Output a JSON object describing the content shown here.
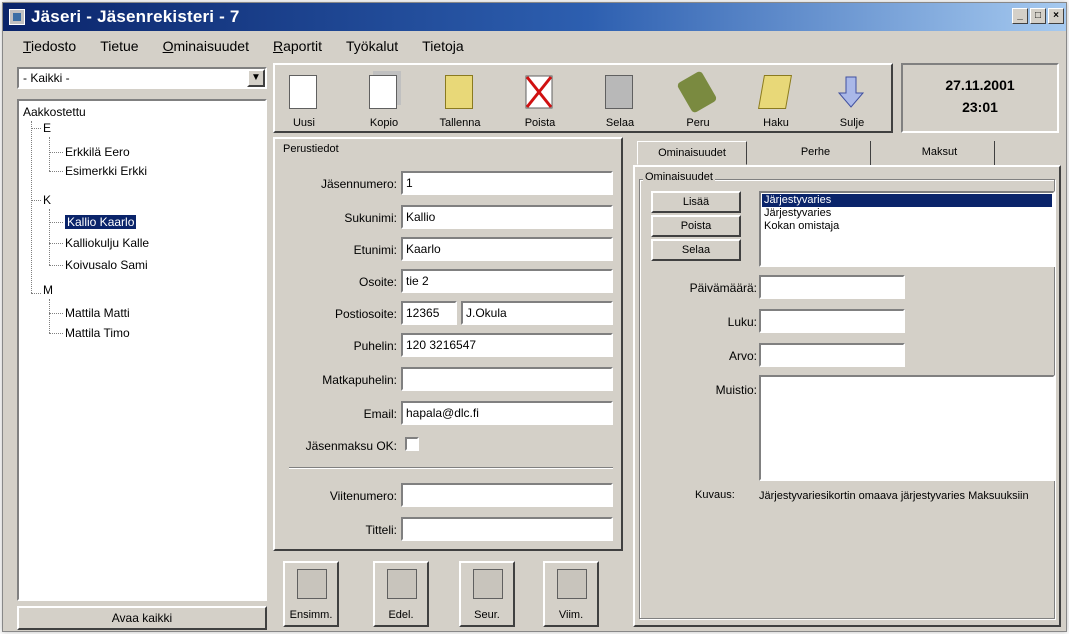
{
  "window": {
    "title": "Jäseri - Jäsenrekisteri - 7",
    "controls": [
      "_",
      "□",
      "×"
    ]
  },
  "menu": [
    {
      "u": "T",
      "rest": "iedosto"
    },
    {
      "u": "",
      "rest": "Tietue"
    },
    {
      "u": "O",
      "rest": "minaisuudet"
    },
    {
      "u": "R",
      "rest": "aportit"
    },
    {
      "u": "",
      "rest": "Työkalut"
    },
    {
      "u": "",
      "rest": "Tietoja"
    }
  ],
  "filter": {
    "value": "- Kaikki -"
  },
  "tree": {
    "root": "Aakkostettu",
    "groups": [
      {
        "letter": "E",
        "items": [
          "Erkkilä Eero",
          "Esimerkki Erkki"
        ]
      },
      {
        "letter": "K",
        "items": [
          "Kallio Kaarlo",
          "Kalliokulju Kalle",
          "Koivusalo Sami"
        ]
      },
      {
        "letter": "M",
        "items": [
          "Mattila Matti",
          "Mattila Timo"
        ]
      }
    ],
    "selected": "Kallio Kaarlo"
  },
  "open_all_label": "Avaa kaikki",
  "toolbar": [
    "Uusi",
    "Kopio",
    "Tallenna",
    "Poista",
    "Selaa",
    "Peru",
    "Haku",
    "Sulje"
  ],
  "datetime": {
    "date": "27.11.2001",
    "time": "23:01"
  },
  "basic": {
    "title": "Perustiedot",
    "member_no_label": "Jäsennumero:",
    "member_no": "1",
    "lastname_label": "Sukunimi:",
    "lastname": "Kallio",
    "firstname_label": "Etunimi:",
    "firstname": "Kaarlo",
    "address_label": "Osoite:",
    "address": "tie 2",
    "postal_label": "Postiosoite:",
    "postal_code": "12365",
    "city": "J.Okula",
    "phone_label": "Puhelin:",
    "phone": "120 3216547",
    "mobile_label": "Matkapuhelin:",
    "mobile": "",
    "email_label": "Email:",
    "email": "hapala@dlc.fi",
    "fee_label": "Jäsenmaksu OK:",
    "ref_label": "Viitenumero:",
    "ref": "",
    "title2_label": "Titteli:",
    "title2": ""
  },
  "nav": [
    "Ensimm.",
    "Edel.",
    "Seur.",
    "Viim."
  ],
  "tabs": [
    "Ominaisuudet",
    "Perhe",
    "Maksut"
  ],
  "props": {
    "group_title": "Ominaisuudet",
    "buttons": [
      "Lisää",
      "Poista",
      "Selaa"
    ],
    "list": [
      "Järjestyvaries",
      "Järjestyvaries",
      "Kokan omistaja"
    ],
    "date_label": "Päivämäärä:",
    "number_label": "Luku:",
    "value_label": "Arvo:",
    "memo_label": "Muistio:",
    "desc_label": "Kuvaus:",
    "desc": "Järjestyvariesikortin omaava järjestyvaries Maksuuksiin"
  },
  "colors": {
    "titlebar": "#0a246a",
    "selection": "#0a246a",
    "face": "#d4d0c8"
  }
}
